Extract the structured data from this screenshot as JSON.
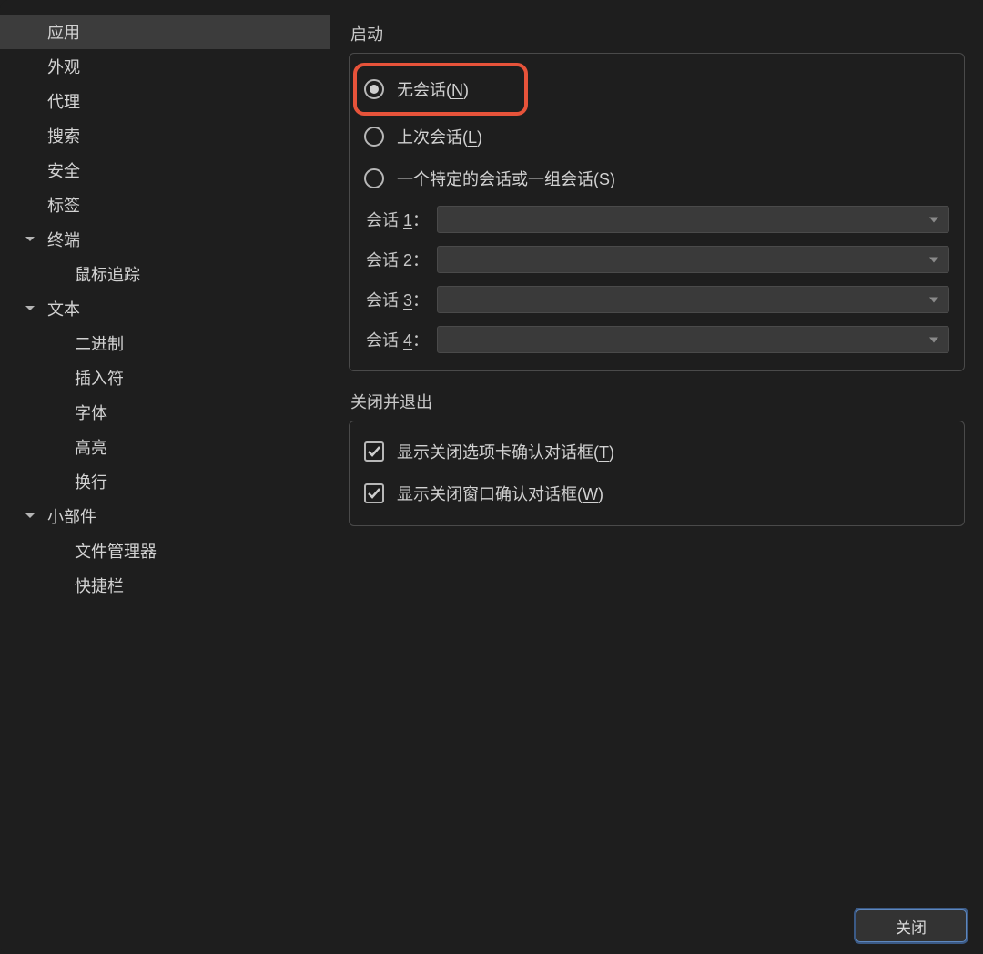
{
  "sidebar": {
    "items": [
      {
        "label": "应用",
        "selected": true
      },
      {
        "label": "外观"
      },
      {
        "label": "代理"
      },
      {
        "label": "搜索"
      },
      {
        "label": "安全"
      },
      {
        "label": "标签"
      },
      {
        "label": "终端",
        "expandable": true
      },
      {
        "label": "鼠标追踪",
        "child": true
      },
      {
        "label": "文本",
        "expandable": true
      },
      {
        "label": "二进制",
        "child": true
      },
      {
        "label": "插入符",
        "child": true
      },
      {
        "label": "字体",
        "child": true
      },
      {
        "label": "高亮",
        "child": true
      },
      {
        "label": "换行",
        "child": true
      },
      {
        "label": "小部件",
        "expandable": true
      },
      {
        "label": "文件管理器",
        "child": true
      },
      {
        "label": "快捷栏",
        "child": true
      }
    ]
  },
  "main": {
    "startup": {
      "heading": "启动",
      "radios": [
        {
          "text": "无会话(",
          "hotkey": "N",
          "tail": ")",
          "checked": true,
          "highlighted": true
        },
        {
          "text": "上次会话(",
          "hotkey": "L",
          "tail": ")"
        },
        {
          "text": "一个特定的会话或一组会话(",
          "hotkey": "S",
          "tail": ")"
        }
      ],
      "sessions": [
        {
          "prefix": "会话 ",
          "hotkey": "1",
          "suffix": "：",
          "value": ""
        },
        {
          "prefix": "会话 ",
          "hotkey": "2",
          "suffix": "：",
          "value": ""
        },
        {
          "prefix": "会话 ",
          "hotkey": "3",
          "suffix": "：",
          "value": ""
        },
        {
          "prefix": "会话 ",
          "hotkey": "4",
          "suffix": "：",
          "value": ""
        }
      ]
    },
    "close_exit": {
      "heading": "关闭并退出",
      "checks": [
        {
          "text": "显示关闭选项卡确认对话框(",
          "hotkey": "T",
          "tail": ")",
          "checked": true
        },
        {
          "text": "显示关闭窗口确认对话框(",
          "hotkey": "W",
          "tail": ")",
          "checked": true
        }
      ]
    }
  },
  "footer": {
    "close": "关闭"
  }
}
